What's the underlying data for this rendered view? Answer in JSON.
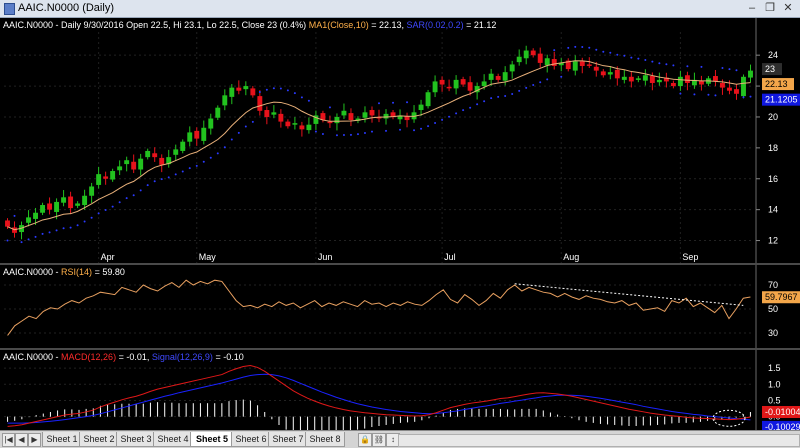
{
  "window": {
    "title": "AAIC.N0000 (Daily)",
    "minimize_glyph": "–",
    "maximize_glyph": "❐",
    "close_glyph": "✕"
  },
  "price_pane": {
    "symbol_line": "AAIC.N0000 - Daily 9/30/2016 Open 22.5, Hi 23.1, Lo 22.5, Close 23 (0.4%)",
    "ma_label": "MA1(Close,10)",
    "ma_value": "= 22.13,",
    "sar_label": "SAR(0.02,0.2)",
    "sar_value": "= 21.12",
    "price_tag_last": "23",
    "price_tag_ma": "22.13",
    "price_tag_sar": "21.1205",
    "y_ticks": [
      "24",
      "22",
      "20",
      "18",
      "16",
      "14",
      "12"
    ],
    "months": [
      "Apr",
      "May",
      "Jun",
      "Jul",
      "Aug",
      "Sep"
    ]
  },
  "rsi_pane": {
    "symbol": "AAIC.N0000 -",
    "label": "RSI(14)",
    "value": "= 59.80",
    "tag": "59.7967",
    "y_ticks": [
      "70",
      "50",
      "30"
    ]
  },
  "macd_pane": {
    "symbol": "AAIC.N0000 -",
    "macd_label": "MACD(12,26)",
    "macd_value": "= -0.01,",
    "signal_label": "Signal(12,26,9)",
    "signal_value": "= -0.10",
    "tag_macd": "-0.01004",
    "tag_signal": "-0.10029",
    "y_ticks": [
      "1.5",
      "1.0",
      "0.5",
      "0.0"
    ]
  },
  "sheets": {
    "tabs": [
      "Sheet 1",
      "Sheet 2",
      "Sheet 3",
      "Sheet 4",
      "Sheet 5",
      "Sheet 6",
      "Sheet 7",
      "Sheet 8"
    ],
    "active": "Sheet 5"
  },
  "colors": {
    "up_candle": "#22c21f",
    "down_candle": "#e8121b",
    "ma_line": "#e8b07a",
    "sar_dots": "#2a3aff",
    "rsi_line": "#e8a060",
    "macd_line": "#e01818",
    "signal_line": "#1a22ff",
    "histogram": "#ffffff"
  },
  "chart_data": [
    {
      "type": "candlestick",
      "title": "AAIC.N0000 - Daily 9/30/2016 Open 22.5, Hi 23.1, Lo 22.5, Close 23 (0.4%)",
      "x_labels": [
        "Apr",
        "May",
        "Jun",
        "Jul",
        "Aug",
        "Sep"
      ],
      "ylim": [
        11,
        25.5
      ],
      "close": [
        12.9,
        12.5,
        13.0,
        13.5,
        13.8,
        14.3,
        14.0,
        14.5,
        14.8,
        14.1,
        14.4,
        14.9,
        15.5,
        16.3,
        16.0,
        16.5,
        16.8,
        17.2,
        16.6,
        17.3,
        17.8,
        17.4,
        16.9,
        17.4,
        17.9,
        18.4,
        19.0,
        18.6,
        19.3,
        19.9,
        20.6,
        21.4,
        21.9,
        21.7,
        22.0,
        21.4,
        20.4,
        20.0,
        20.3,
        19.7,
        19.4,
        19.6,
        19.2,
        19.5,
        20.1,
        19.8,
        19.6,
        20.0,
        20.4,
        19.8,
        19.9,
        20.3,
        20.1,
        19.9,
        20.2,
        20.0,
        20.1,
        19.8,
        20.3,
        20.8,
        21.6,
        22.3,
        22.1,
        21.9,
        22.4,
        22.1,
        21.7,
        22.0,
        22.3,
        22.8,
        22.4,
        22.9,
        23.4,
        23.9,
        24.3,
        24.0,
        23.5,
        23.8,
        23.3,
        23.5,
        23.1,
        23.6,
        23.3,
        23.4,
        23.0,
        22.7,
        22.9,
        22.5,
        22.6,
        22.3,
        22.5,
        22.7,
        22.2,
        22.4,
        22.3,
        22.0,
        22.6,
        22.2,
        22.4,
        22.1,
        22.5,
        22.3,
        21.9,
        21.7,
        21.5,
        22.6,
        23.0
      ],
      "series": [
        {
          "name": "MA1(Close,10)",
          "last": 22.13
        },
        {
          "name": "SAR(0.02,0.2)",
          "last": 21.12
        }
      ],
      "last_close": 23
    },
    {
      "type": "line",
      "series": [
        {
          "name": "RSI(14)",
          "last": 59.8
        }
      ],
      "ylim": [
        20,
        80
      ],
      "y_ticks": [
        30,
        50,
        70
      ],
      "values": [
        28,
        36,
        40,
        44,
        42,
        48,
        51,
        50,
        54,
        57,
        55,
        59,
        61,
        64,
        63,
        62,
        68,
        66,
        64,
        70,
        67,
        65,
        69,
        72,
        68,
        74,
        70,
        73,
        71,
        74,
        73,
        65,
        57,
        52,
        53,
        51,
        54,
        52,
        56,
        53,
        55,
        51,
        54,
        57,
        52,
        55,
        53,
        56,
        54,
        52,
        57,
        54,
        55,
        52,
        55,
        53,
        56,
        54,
        53,
        57,
        62,
        66,
        58,
        55,
        62,
        58,
        53,
        57,
        63,
        59,
        66,
        70,
        65,
        68,
        66,
        64,
        63,
        60,
        63,
        60,
        58,
        61,
        59,
        58,
        56,
        55,
        57,
        53,
        55,
        49,
        50,
        51,
        48,
        57,
        55,
        59,
        52,
        55,
        51,
        47,
        53,
        42,
        50,
        59,
        60
      ]
    },
    {
      "type": "line",
      "series": [
        {
          "name": "MACD(12,26)",
          "last": -0.01
        },
        {
          "name": "Signal(12,26,9)",
          "last": -0.1
        },
        {
          "name": "Histogram"
        }
      ],
      "ylim": [
        -0.35,
        1.75
      ],
      "y_ticks": [
        0.0,
        0.5,
        1.0,
        1.5
      ],
      "macd": [
        -0.3,
        -0.28,
        -0.25,
        -0.2,
        -0.15,
        -0.1,
        -0.05,
        0.0,
        0.05,
        0.08,
        0.1,
        0.15,
        0.2,
        0.3,
        0.38,
        0.45,
        0.52,
        0.58,
        0.63,
        0.7,
        0.78,
        0.85,
        0.9,
        0.95,
        1.0,
        1.05,
        1.1,
        1.15,
        1.2,
        1.25,
        1.3,
        1.4,
        1.48,
        1.55,
        1.58,
        1.52,
        1.4,
        1.25,
        1.1,
        0.95,
        0.8,
        0.68,
        0.57,
        0.48,
        0.4,
        0.33,
        0.27,
        0.22,
        0.18,
        0.15,
        0.12,
        0.1,
        0.08,
        0.06,
        0.05,
        0.04,
        0.03,
        0.02,
        0.03,
        0.06,
        0.12,
        0.2,
        0.28,
        0.33,
        0.38,
        0.42,
        0.45,
        0.48,
        0.52,
        0.56,
        0.58,
        0.62,
        0.66,
        0.7,
        0.73,
        0.74,
        0.72,
        0.7,
        0.67,
        0.63,
        0.58,
        0.53,
        0.48,
        0.43,
        0.38,
        0.33,
        0.28,
        0.23,
        0.19,
        0.15,
        0.11,
        0.08,
        0.05,
        0.03,
        0.01,
        -0.02,
        -0.04,
        -0.05,
        -0.06,
        -0.07,
        -0.08,
        -0.09,
        -0.08,
        -0.05,
        -0.01
      ],
      "signal": [
        -0.2,
        -0.2,
        -0.2,
        -0.19,
        -0.18,
        -0.16,
        -0.14,
        -0.12,
        -0.09,
        -0.06,
        -0.03,
        0.0,
        0.04,
        0.09,
        0.15,
        0.21,
        0.27,
        0.33,
        0.39,
        0.45,
        0.51,
        0.57,
        0.63,
        0.68,
        0.74,
        0.79,
        0.84,
        0.89,
        0.94,
        0.99,
        1.04,
        1.1,
        1.16,
        1.22,
        1.27,
        1.3,
        1.31,
        1.3,
        1.26,
        1.2,
        1.12,
        1.03,
        0.94,
        0.85,
        0.76,
        0.68,
        0.6,
        0.53,
        0.46,
        0.4,
        0.35,
        0.3,
        0.26,
        0.22,
        0.19,
        0.16,
        0.14,
        0.12,
        0.1,
        0.09,
        0.1,
        0.12,
        0.15,
        0.18,
        0.22,
        0.26,
        0.3,
        0.33,
        0.37,
        0.41,
        0.44,
        0.48,
        0.51,
        0.55,
        0.58,
        0.62,
        0.64,
        0.66,
        0.66,
        0.66,
        0.65,
        0.63,
        0.6,
        0.57,
        0.53,
        0.49,
        0.45,
        0.41,
        0.37,
        0.32,
        0.28,
        0.24,
        0.2,
        0.16,
        0.13,
        0.1,
        0.07,
        0.05,
        0.02,
        0.0,
        -0.02,
        -0.04,
        -0.06,
        -0.08,
        -0.1
      ]
    }
  ]
}
